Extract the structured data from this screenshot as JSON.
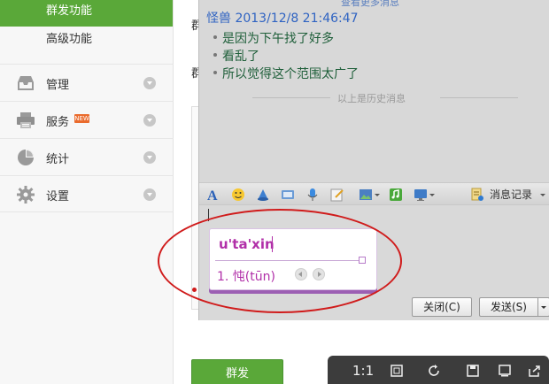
{
  "sidebar": {
    "sub_items": [
      {
        "label": "群发功能",
        "active": true
      },
      {
        "label": "高级功能",
        "active": false
      }
    ],
    "menu_items": [
      {
        "label": "管理",
        "icon": "inbox-icon"
      },
      {
        "label": "服务",
        "icon": "printer-icon",
        "badge": "NEW"
      },
      {
        "label": "统计",
        "icon": "pie-chart-icon"
      },
      {
        "label": "设置",
        "icon": "gear-icon"
      }
    ]
  },
  "background": {
    "label_a": "群",
    "label_b": "群",
    "send_button": "群发"
  },
  "chat": {
    "more_messages": "查看更多消息",
    "sender_line": "怪兽 2013/12/8 21:46:47",
    "messages": [
      "是因为下午找了好多",
      "看乱了",
      "所以觉得这个范围太广了"
    ],
    "history_divider": "以上是历史消息",
    "message_record": "消息记录",
    "close_button": "关闭(C)",
    "send_button": "发送(S)"
  },
  "ime": {
    "pinyin": "u'ta'xin",
    "candidate": "1. 忳(tūn)"
  },
  "viewer": {
    "zoom": "1:1"
  },
  "colors": {
    "accent_green": "#5aa839",
    "annotation_red": "#d01b1b",
    "ime_purple": "#b12fa8",
    "sender_blue": "#2f63c2",
    "message_green": "#1f5f3a"
  }
}
